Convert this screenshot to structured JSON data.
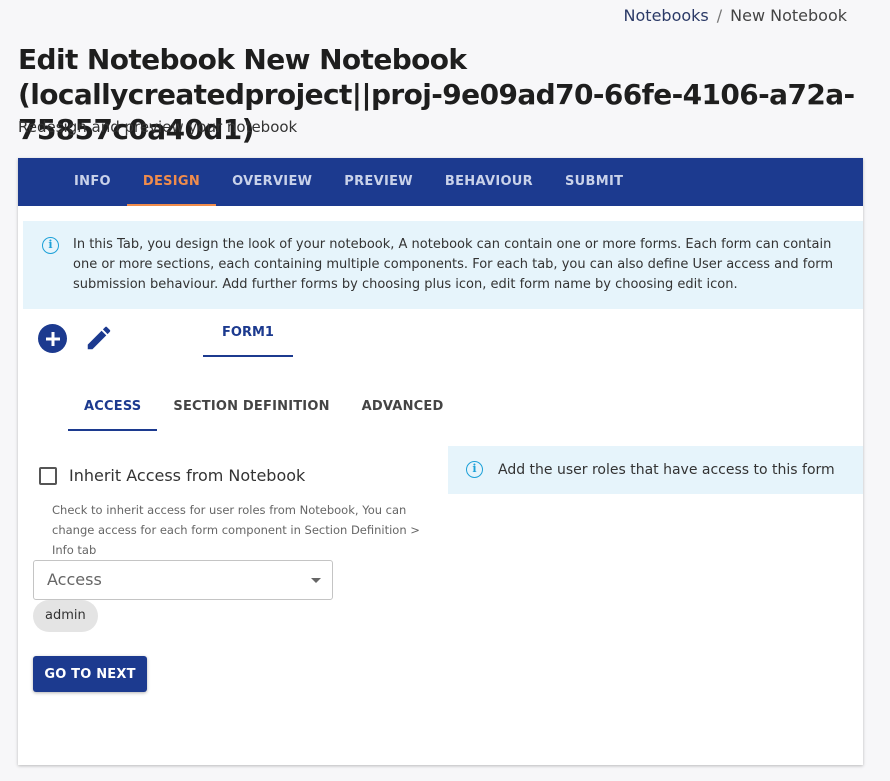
{
  "breadcrumb": {
    "parent": "Notebooks",
    "separator": "/",
    "current": "New Notebook"
  },
  "page": {
    "title": "Edit Notebook New Notebook (locallycreatedproject||proj-9e09ad70-66fe-4106-a72a-75857c0a40d1)",
    "subtitle": "Redesign and preview your notebook"
  },
  "tabs": [
    {
      "label": "INFO",
      "active": false
    },
    {
      "label": "DESIGN",
      "active": true
    },
    {
      "label": "OVERVIEW",
      "active": false
    },
    {
      "label": "PREVIEW",
      "active": false
    },
    {
      "label": "BEHAVIOUR",
      "active": false
    },
    {
      "label": "SUBMIT",
      "active": false
    }
  ],
  "info": {
    "text": "In this Tab, you design the look of your notebook, A notebook can contain one or more forms. Each form can contain one or more sections, each containing multiple components. For each tab, you can also define User access and form submission behaviour. Add further forms by choosing plus icon, edit form name by choosing edit icon."
  },
  "icons": {
    "add": "plus-circle-icon",
    "edit": "pencil-icon",
    "info": "info-circle-icon",
    "dropdown": "caret-down-icon"
  },
  "form_tab": {
    "label": "FORM1"
  },
  "subtabs": [
    {
      "label": "ACCESS",
      "active": true
    },
    {
      "label": "SECTION DEFINITION",
      "active": false
    },
    {
      "label": "ADVANCED",
      "active": false
    }
  ],
  "access": {
    "inherit_label": "Inherit Access from Notebook",
    "inherit_checked": false,
    "helper": "Check to inherit access for user roles from Notebook, You can change access for each form component in Section Definition > Info tab",
    "select_placeholder": "Access",
    "chips": [
      "admin"
    ],
    "side_info": "Add the user roles that have access to this form"
  },
  "actions": {
    "next_label": "GO TO NEXT"
  },
  "colors": {
    "primary": "#1c3a8f",
    "active_tab": "#f08c4c",
    "info_bg": "#e6f4fb",
    "info_icon": "#1da1d8"
  }
}
